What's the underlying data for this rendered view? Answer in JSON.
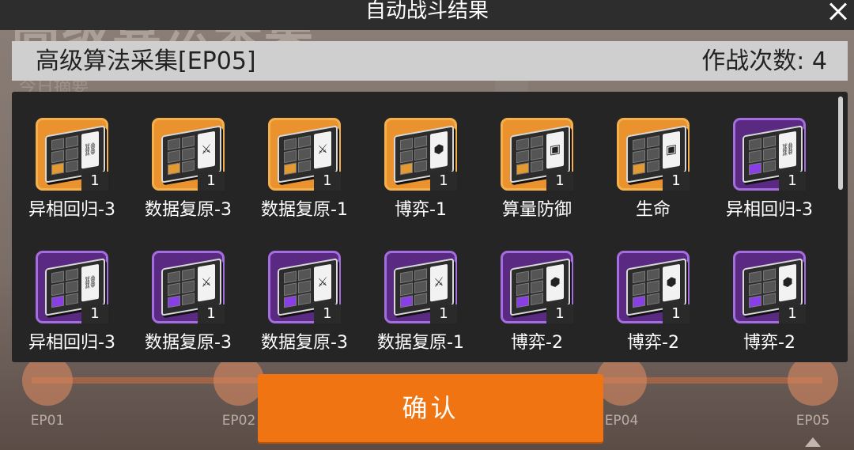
{
  "background": {
    "title": "高级算法采集",
    "subtitle": "今日摘要",
    "nodes": [
      "EP01",
      "EP02",
      "EP04",
      "EP05"
    ]
  },
  "dialog": {
    "title": "自动战斗结果",
    "close_icon": "close-icon"
  },
  "stage": {
    "name": "高级算法采集[EP05]",
    "battle_count": "作战次数: 4"
  },
  "rewards": [
    {
      "name": "异相回归-3",
      "qty": "1",
      "rarity": "orange",
      "symbol": "⛓"
    },
    {
      "name": "数据复原-3",
      "qty": "1",
      "rarity": "orange",
      "symbol": "⚔"
    },
    {
      "name": "数据复原-1",
      "qty": "1",
      "rarity": "orange",
      "symbol": "⚔"
    },
    {
      "name": "博弈-1",
      "qty": "1",
      "rarity": "orange",
      "symbol": "⬢"
    },
    {
      "name": "算量防御",
      "qty": "1",
      "rarity": "orange",
      "symbol": "▣"
    },
    {
      "name": "生命",
      "qty": "1",
      "rarity": "orange",
      "symbol": "▣"
    },
    {
      "name": "异相回归-3",
      "qty": "1",
      "rarity": "purple",
      "symbol": "⛓"
    },
    {
      "name": "异相回归-3",
      "qty": "1",
      "rarity": "purple",
      "symbol": "⛓"
    },
    {
      "name": "数据复原-3",
      "qty": "1",
      "rarity": "purple",
      "symbol": "⚔"
    },
    {
      "name": "数据复原-3",
      "qty": "1",
      "rarity": "purple",
      "symbol": "⚔"
    },
    {
      "name": "数据复原-1",
      "qty": "1",
      "rarity": "purple",
      "symbol": "⚔"
    },
    {
      "name": "博弈-2",
      "qty": "1",
      "rarity": "purple",
      "symbol": "⬢"
    },
    {
      "name": "博弈-2",
      "qty": "1",
      "rarity": "purple",
      "symbol": "⬢"
    },
    {
      "name": "博弈-2",
      "qty": "1",
      "rarity": "purple",
      "symbol": "⬢"
    }
  ],
  "confirm_label": "确认",
  "colors": {
    "accent": "#f07512",
    "orange_rarity": "#e9922e",
    "purple_rarity": "#5a2a82"
  }
}
